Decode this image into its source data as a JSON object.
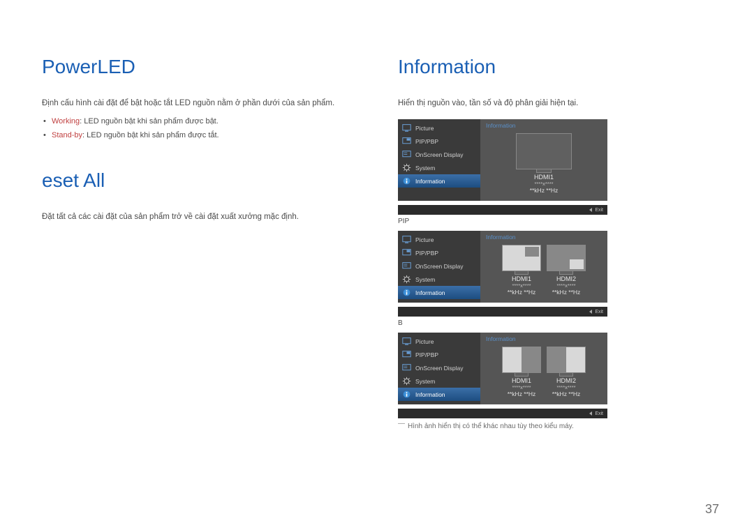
{
  "left": {
    "heading1": "PowerLED",
    "intro1": "Định cấu hình cài đặt để bật hoặc tắt LED nguồn nằm ở phần dưới của sản phẩm.",
    "bullets": [
      {
        "label": "Working",
        "rest": ": LED nguồn bật khi sản phẩm được bật."
      },
      {
        "label": "Stand-by",
        "rest": ": LED nguồn bật khi sản phẩm được tắt."
      }
    ],
    "heading2": "eset All",
    "intro2": "Đặt tất cả các cài đặt của sản phẩm trở về cài đặt xuất xưởng mặc định."
  },
  "right": {
    "heading": "Information",
    "intro": "Hiển thị nguồn vào, tần số và độ phân giải hiện tại.",
    "menu_items": [
      "Picture",
      "PIP/PBP",
      "OnScreen Display",
      "System",
      "Information"
    ],
    "panel_title": "Information",
    "sources": {
      "single": {
        "name": "HDMI1",
        "res": "****x****",
        "freq": "**kHz **Hz"
      },
      "dual": [
        {
          "name": "HDMI1",
          "res": "****x****",
          "freq": "**kHz **Hz"
        },
        {
          "name": "HDMI2",
          "res": "****x****",
          "freq": "**kHz **Hz"
        }
      ]
    },
    "caption_pip": "PIP",
    "caption_b": "B",
    "exit": "Exit",
    "note": "Hình ảnh hiển thị có thể khác nhau tùy theo kiểu máy."
  },
  "page_number": "37"
}
